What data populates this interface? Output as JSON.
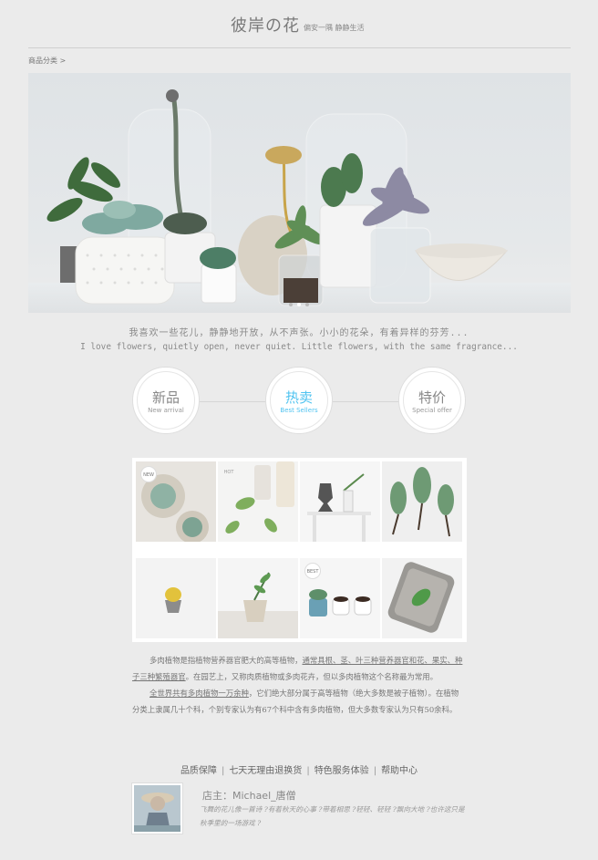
{
  "header": {
    "title": "彼岸の花",
    "tagline": "偏安一隅 静静生活"
  },
  "breadcrumb": "商品分类 >",
  "intro": {
    "cn": "我喜欢一些花儿，静静地开放，从不声张。小小的花朵，有着异样的芬芳...",
    "en": "I love flowers, quietly open, never quiet. Little flowers, with the same fragrance..."
  },
  "categories": [
    {
      "cn": "新品",
      "en": "New arrival"
    },
    {
      "cn": "热卖",
      "en": "Best Sellers"
    },
    {
      "cn": "特价",
      "en": "Special offer"
    }
  ],
  "badges": {
    "new": "NEW",
    "hot": "HOT",
    "best": "BEST"
  },
  "description": {
    "p1_a": "多肉植物是指植物营养器官肥大的高等植物，",
    "p1_u1": "通常具根、茎、叶三种营养器官和花、果实、种子三种繁殖器官",
    "p1_b": "。在园艺上，又称肉质植物或多肉花卉，但以多肉植物这个名称最为常用。",
    "p2_u": "全世界共有多肉植物一万余种",
    "p2_b": "，它们绝大部分属于高等植物（绝大多数是被子植物）。在植物分类上隶属几十个科，个别专家认为有67个科中含有多肉植物，但大多数专家认为只有50余科。"
  },
  "footer_links": [
    "品质保障",
    "七天无理由退换货",
    "特色服务体验",
    "帮助中心"
  ],
  "footer_sep": "|",
  "owner": {
    "label": "店主：Michael_唐僧",
    "poem": "飞舞的花儿像一首诗 ?有着秋天的心事 ?带着相思 ?轻轻、轻轻 ?飘向大地 ?也许这只是秋季里的一场游戏 ?"
  },
  "colors": {
    "background": "#ebebeb",
    "accent": "#4fc3f0"
  }
}
